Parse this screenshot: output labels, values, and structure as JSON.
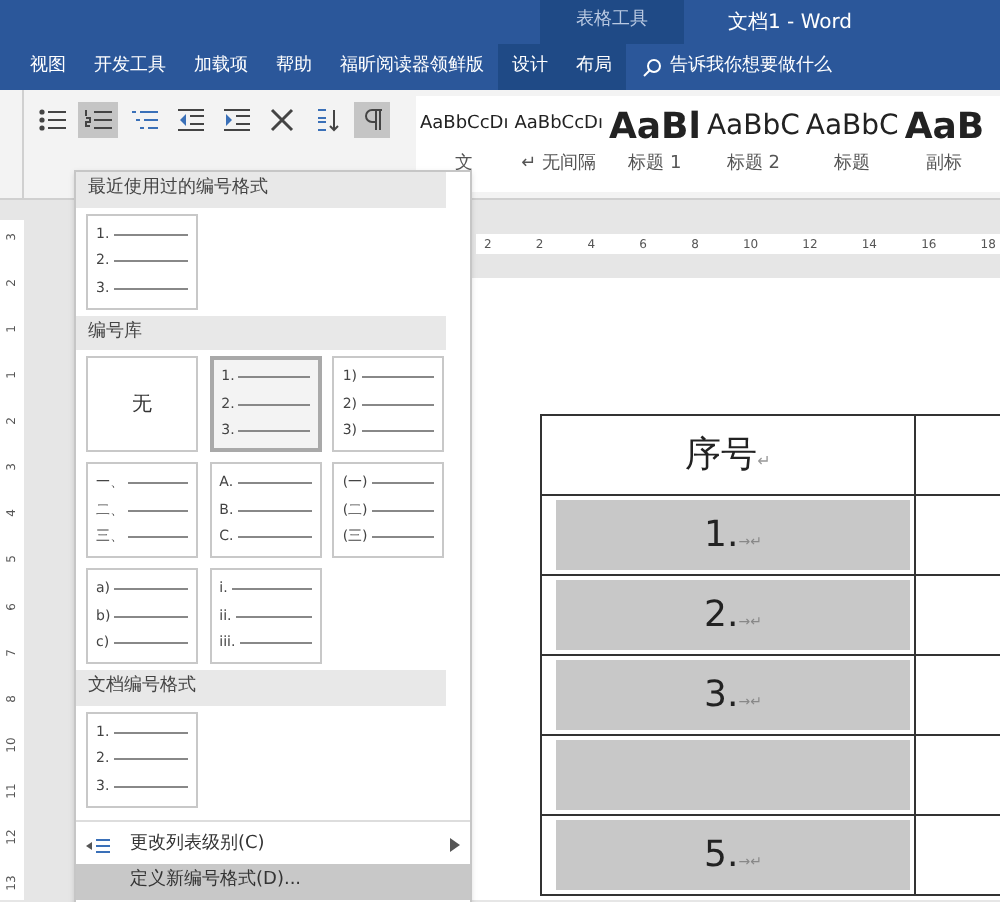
{
  "title_bar": {
    "context_group": "表格工具",
    "title": "文档1  -  Word"
  },
  "tabs": [
    {
      "label": "视图",
      "context": false
    },
    {
      "label": "开发工具",
      "context": false
    },
    {
      "label": "加载项",
      "context": false
    },
    {
      "label": "帮助",
      "context": false
    },
    {
      "label": "福昕阅读器领鲜版",
      "context": false
    },
    {
      "label": "设计",
      "context": true
    },
    {
      "label": "布局",
      "context": true
    }
  ],
  "tell_me": {
    "placeholder": "告诉我你想要做什么"
  },
  "toolbar": [
    {
      "kind": "bullets",
      "pressed": false
    },
    {
      "kind": "numbering",
      "pressed": true
    },
    {
      "kind": "multilevel",
      "pressed": false
    },
    {
      "kind": "outdent",
      "pressed": false
    },
    {
      "kind": "indent",
      "pressed": false
    },
    {
      "kind": "asian",
      "pressed": false
    },
    {
      "kind": "sort",
      "pressed": false
    },
    {
      "kind": "marks",
      "pressed": true
    }
  ],
  "styles": [
    {
      "sample": "AaBbCcDı",
      "label": "文",
      "kind": "small"
    },
    {
      "sample": "AaBbCcDı",
      "label": "↵ 无间隔",
      "kind": "small"
    },
    {
      "sample": "AaBl",
      "label": "标题 1",
      "kind": "big"
    },
    {
      "sample": "AaBbC",
      "label": "标题 2",
      "kind": "mid"
    },
    {
      "sample": "AaBbC",
      "label": "标题",
      "kind": "mid"
    },
    {
      "sample": "AaB",
      "label": "副标",
      "kind": "big"
    }
  ],
  "ruler": {
    "ticks": [
      "2",
      "2",
      "4",
      "6",
      "8",
      "10",
      "12",
      "14",
      "16",
      "18"
    ]
  },
  "vertical_ruler": {
    "ticks": [
      "3",
      "2",
      "1",
      "1",
      "2",
      "3",
      "4",
      "5",
      "6",
      "7",
      "8",
      "10",
      "11",
      "12",
      "13"
    ]
  },
  "menu": {
    "sections": [
      {
        "title": "最近使用过的编号格式",
        "tiles": [
          {
            "kind": "list",
            "selected": false,
            "items": [
              "1.",
              "2.",
              "3."
            ]
          }
        ]
      },
      {
        "title": "编号库",
        "tiles": [
          {
            "kind": "none",
            "selected": false,
            "text": "无"
          },
          {
            "kind": "list",
            "selected": true,
            "items": [
              "1.",
              "2.",
              "3."
            ]
          },
          {
            "kind": "list",
            "selected": false,
            "items": [
              "1)",
              "2)",
              "3)"
            ]
          },
          {
            "kind": "list",
            "selected": false,
            "items": [
              "一、",
              "二、",
              "三、"
            ]
          },
          {
            "kind": "list",
            "selected": false,
            "items": [
              "A.",
              "B.",
              "C."
            ]
          },
          {
            "kind": "list",
            "selected": false,
            "items": [
              "(一)",
              "(二)",
              "(三)"
            ]
          },
          {
            "kind": "list",
            "selected": false,
            "items": [
              "a)",
              "b)",
              "c)"
            ]
          },
          {
            "kind": "list",
            "selected": false,
            "items": [
              "i.",
              "ii.",
              "iii."
            ]
          }
        ]
      },
      {
        "title": "文档编号格式",
        "tiles": [
          {
            "kind": "list",
            "selected": false,
            "items": [
              "1.",
              "2.",
              "3."
            ]
          }
        ]
      }
    ],
    "items": [
      {
        "label": "更改列表级别(C)",
        "submenu": true,
        "highlighted": false
      },
      {
        "label": "定义新编号格式(D)...",
        "submenu": false,
        "highlighted": true
      }
    ]
  },
  "table": {
    "header": {
      "text": "序号",
      "mark": "↵"
    },
    "rows": [
      {
        "number": "1.",
        "marks": "→↵",
        "shaded": true
      },
      {
        "number": "2.",
        "marks": "→↵",
        "shaded": true
      },
      {
        "number": "3.",
        "marks": "→↵",
        "shaded": true
      },
      {
        "shaded": true
      },
      {
        "number": "5.",
        "marks": "→↵",
        "shaded": true
      }
    ]
  }
}
